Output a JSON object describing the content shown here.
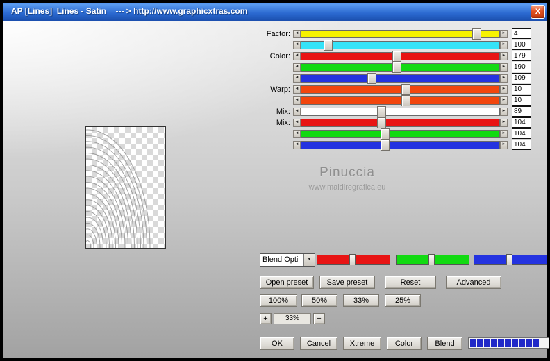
{
  "window": {
    "title": "AP [Lines]  Lines - Satin    --- > http://www.graphicxtras.com"
  },
  "icons": {
    "close": "X",
    "left_arrow": "◄",
    "right_arrow": "►",
    "dropdown_arrow": "▼"
  },
  "sliders": {
    "rows": [
      {
        "label": "Factor:",
        "color": "#f6f200",
        "value": "4",
        "pos": 0.9
      },
      {
        "label": "",
        "color": "#35e3f8",
        "value": "100",
        "pos": 0.12
      },
      {
        "label": "Color:",
        "color": "#e81414",
        "value": "179",
        "pos": 0.48
      },
      {
        "label": "",
        "color": "#12da12",
        "value": "190",
        "pos": 0.48
      },
      {
        "label": "",
        "color": "#2433e0",
        "value": "109",
        "pos": 0.35
      },
      {
        "label": "Warp:",
        "color": "#f2460e",
        "value": "10",
        "pos": 0.53
      },
      {
        "label": "",
        "color": "#f2460e",
        "value": "10",
        "pos": 0.53
      },
      {
        "label": "Mix:",
        "color": "#ffffff",
        "value": "89",
        "pos": 0.4
      },
      {
        "label": "Mix:",
        "color": "#e81414",
        "value": "104",
        "pos": 0.4
      },
      {
        "label": "",
        "color": "#12da12",
        "value": "104",
        "pos": 0.42
      },
      {
        "label": "",
        "color": "#2433e0",
        "value": "104",
        "pos": 0.42
      }
    ]
  },
  "watermark": {
    "name": "Pinuccia",
    "site": "www.maidiregrafica.eu"
  },
  "blend": {
    "dropdown_value": "Blend Opti",
    "channel_sliders": [
      {
        "name": "red",
        "color": "#e81414",
        "pos": 0.45
      },
      {
        "name": "green",
        "color": "#12da12",
        "pos": 0.45
      },
      {
        "name": "blue",
        "color": "#2433e0",
        "pos": 0.45
      }
    ]
  },
  "buttons": {
    "presets": [
      "Open preset",
      "Save preset",
      "Reset",
      "Advanced"
    ],
    "zoom_presets": [
      "100%",
      "50%",
      "33%",
      "25%"
    ],
    "zoom": {
      "plus": "+",
      "value": "33%",
      "minus": "−"
    },
    "actions": [
      "OK",
      "Cancel",
      "Xtreme",
      "Color",
      "Blend"
    ]
  },
  "progress": {
    "segments": 10,
    "color": "#2129c8"
  }
}
